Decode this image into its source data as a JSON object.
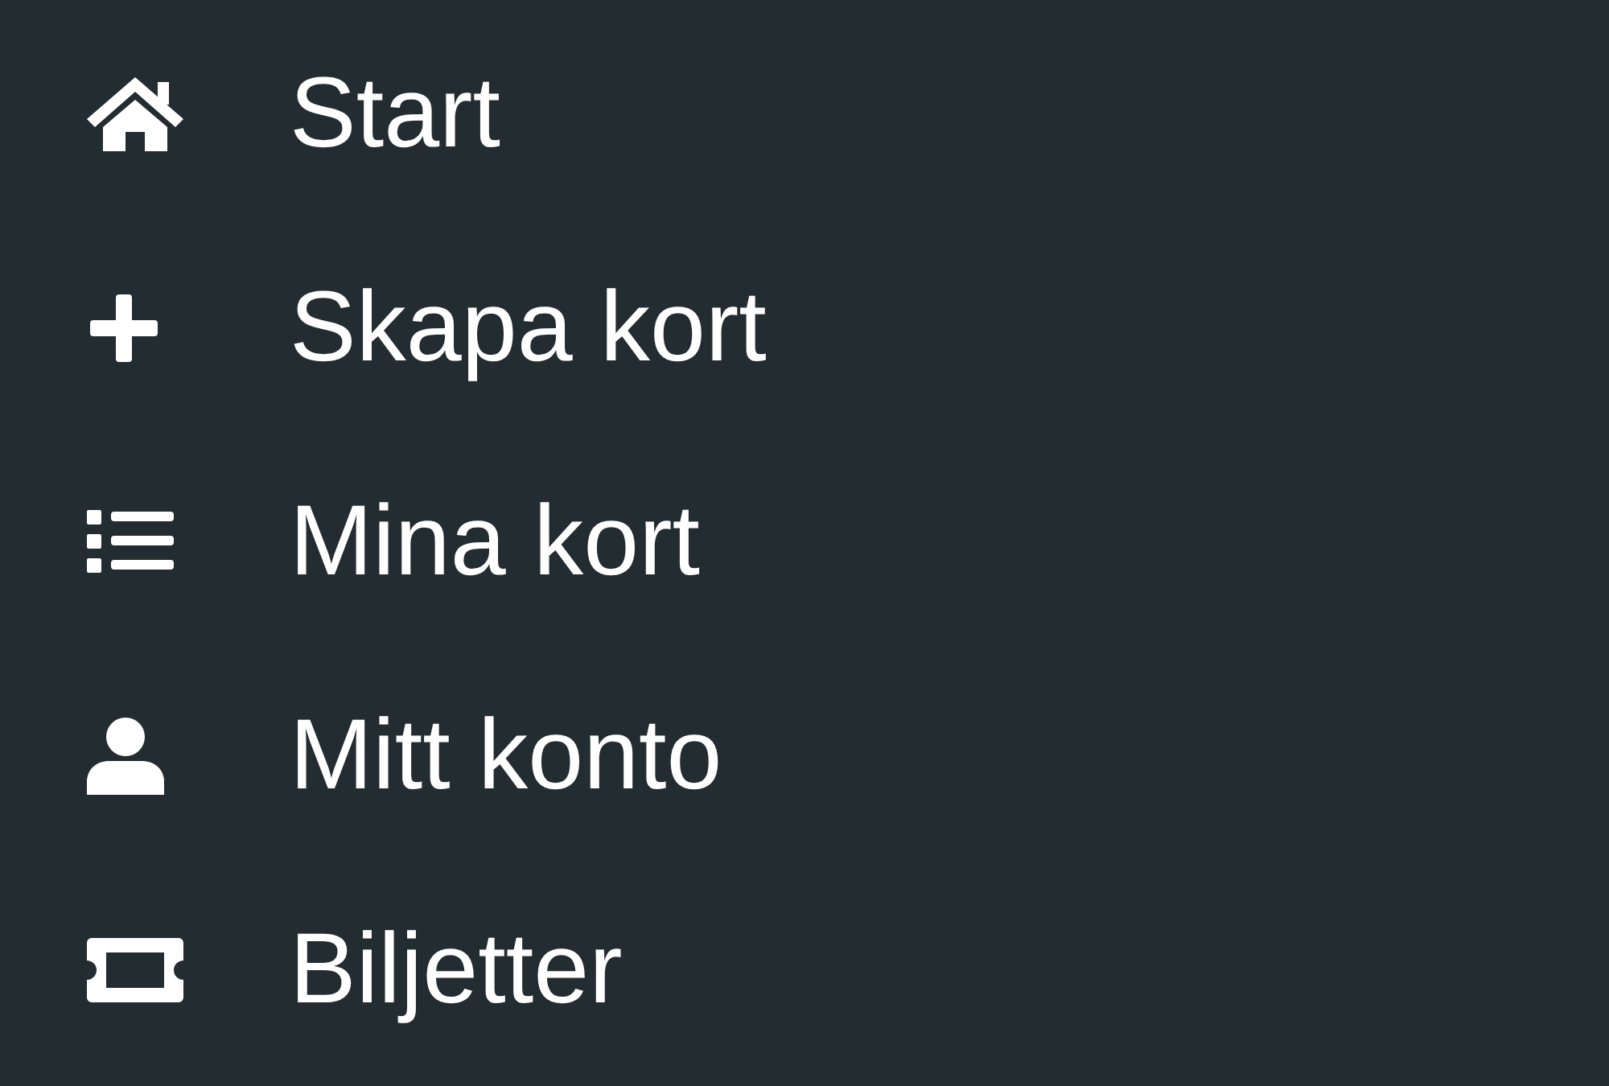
{
  "menu": {
    "items": [
      {
        "kind": "home",
        "label": "Start"
      },
      {
        "kind": "plus",
        "label": "Skapa kort"
      },
      {
        "kind": "list",
        "label": "Mina kort"
      },
      {
        "kind": "user",
        "label": "Mitt konto"
      },
      {
        "kind": "ticket",
        "label": "Biljetter"
      }
    ]
  }
}
